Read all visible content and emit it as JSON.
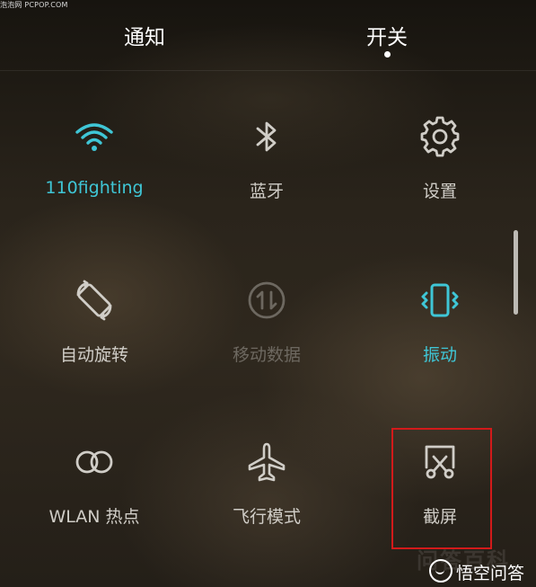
{
  "watermark_top": "泡泡网 PCPOP.COM",
  "tabs": [
    {
      "label": "通知",
      "selected": false
    },
    {
      "label": "开关",
      "selected": true
    }
  ],
  "colors": {
    "active": "#3fc6d6",
    "normal": "#d0cdc7",
    "disabled": "#6d6860",
    "highlight_box": "#d21a1a"
  },
  "tiles": [
    {
      "label": "110fighting",
      "icon": "wifi-icon",
      "state": "active"
    },
    {
      "label": "蓝牙",
      "icon": "bluetooth-icon",
      "state": "off"
    },
    {
      "label": "设置",
      "icon": "gear-icon",
      "state": "off"
    },
    {
      "label": "自动旋转",
      "icon": "auto-rotate-icon",
      "state": "off"
    },
    {
      "label": "移动数据",
      "icon": "mobile-data-icon",
      "state": "disabled"
    },
    {
      "label": "振动",
      "icon": "vibrate-icon",
      "state": "active"
    },
    {
      "label": "WLAN 热点",
      "icon": "hotspot-icon",
      "state": "off"
    },
    {
      "label": "飞行模式",
      "icon": "airplane-icon",
      "state": "off"
    },
    {
      "label": "截屏",
      "icon": "screenshot-icon",
      "state": "off"
    }
  ],
  "watermark_bottom": {
    "ghost_text": "问答百科",
    "account": "悟空问答"
  }
}
